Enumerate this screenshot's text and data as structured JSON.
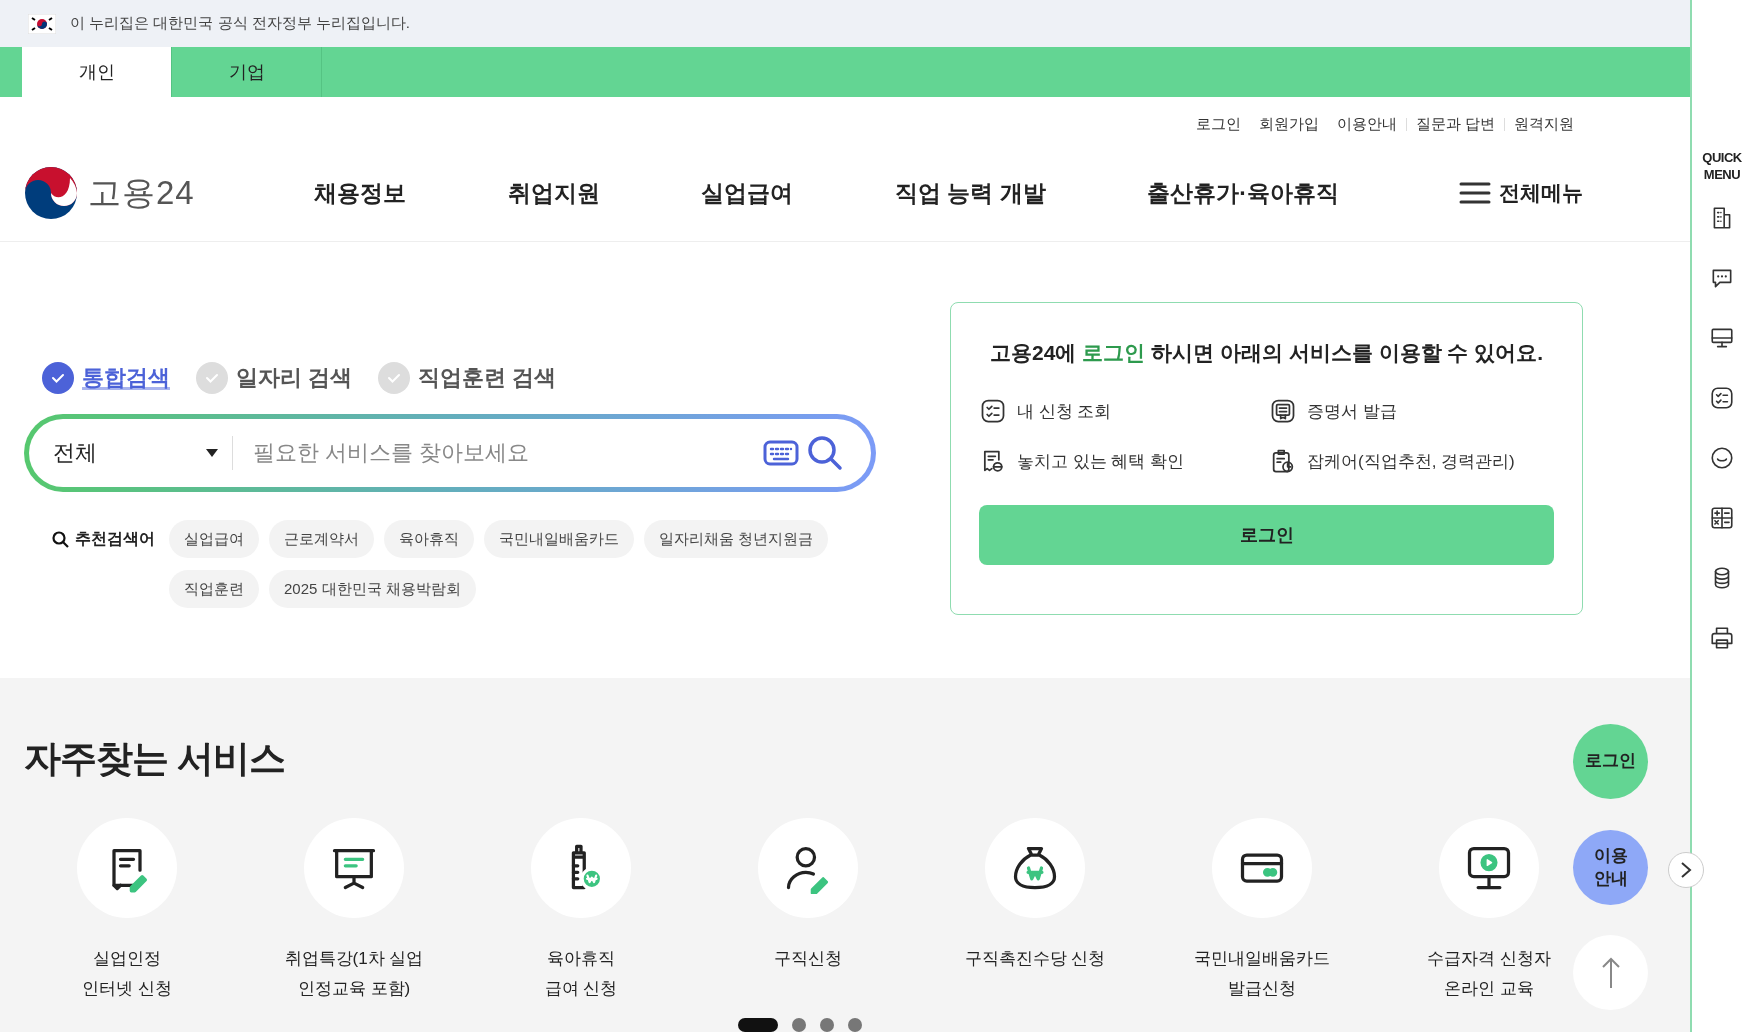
{
  "gov_banner": {
    "text": "이 누리집은 대한민국 공식 전자정부 누리집입니다."
  },
  "audience_tabs": [
    {
      "label": "개인",
      "selected": true
    },
    {
      "label": "기업",
      "selected": false
    }
  ],
  "utility_links": [
    "로그인",
    "회원가입",
    "이용안내",
    "질문과 답변",
    "원격지원"
  ],
  "logo": {
    "text": "고용24"
  },
  "nav": [
    "채용정보",
    "취업지원",
    "실업급여",
    "직업 능력 개발",
    "출산휴가·육아휴직"
  ],
  "all_menu": "전체메뉴",
  "search_types": [
    {
      "label": "통합검색",
      "selected": true
    },
    {
      "label": "일자리 검색",
      "selected": false
    },
    {
      "label": "직업훈련 검색",
      "selected": false
    }
  ],
  "search": {
    "category": "전체",
    "placeholder": "필요한 서비스를 찾아보세요"
  },
  "recommended": {
    "label": "추천검색어",
    "keywords": [
      "실업급여",
      "근로계약서",
      "육아휴직",
      "국민내일배움카드",
      "일자리채움 청년지원금",
      "직업훈련",
      "2025 대한민국 채용박람회"
    ]
  },
  "login_panel": {
    "headline_before": "고용24에",
    "headline_highlight": "로그인",
    "headline_after": "하시면 아래의 서비스를 이용할 수 있어요.",
    "services": [
      {
        "label": "내 신청 조회",
        "kind": "checklist"
      },
      {
        "label": "증명서 발급",
        "kind": "certificate"
      },
      {
        "label": "놓치고 있는 혜택 확인",
        "kind": "receipt"
      },
      {
        "label": "잡케어(직업추천, 경력관리)",
        "kind": "clipboard"
      }
    ],
    "button": "로그인"
  },
  "frequent_services": {
    "title": "자주찾는 서비스",
    "items": [
      {
        "label": "실업인정\n인터넷 신청",
        "kind": "document-pen"
      },
      {
        "label": "취업특강(1차 실업\n인정교육 포함)",
        "kind": "presentation"
      },
      {
        "label": "육아휴직\n급여 신청",
        "kind": "bottle"
      },
      {
        "label": "구직신청",
        "kind": "person-pen"
      },
      {
        "label": "구직촉진수당 신청",
        "kind": "money-bag"
      },
      {
        "label": "국민내일배움카드\n발급신청",
        "kind": "card"
      },
      {
        "label": "수급자격 신청자\n온라인 교육",
        "kind": "monitor-play"
      }
    ]
  },
  "pager": [
    {
      "selected": true
    },
    {
      "selected": false
    },
    {
      "selected": false
    },
    {
      "selected": false
    }
  ],
  "floating": {
    "login": "로그인",
    "guide": "이용\n안내"
  },
  "quick_menu": {
    "title": "QUICK\nMENU"
  }
}
